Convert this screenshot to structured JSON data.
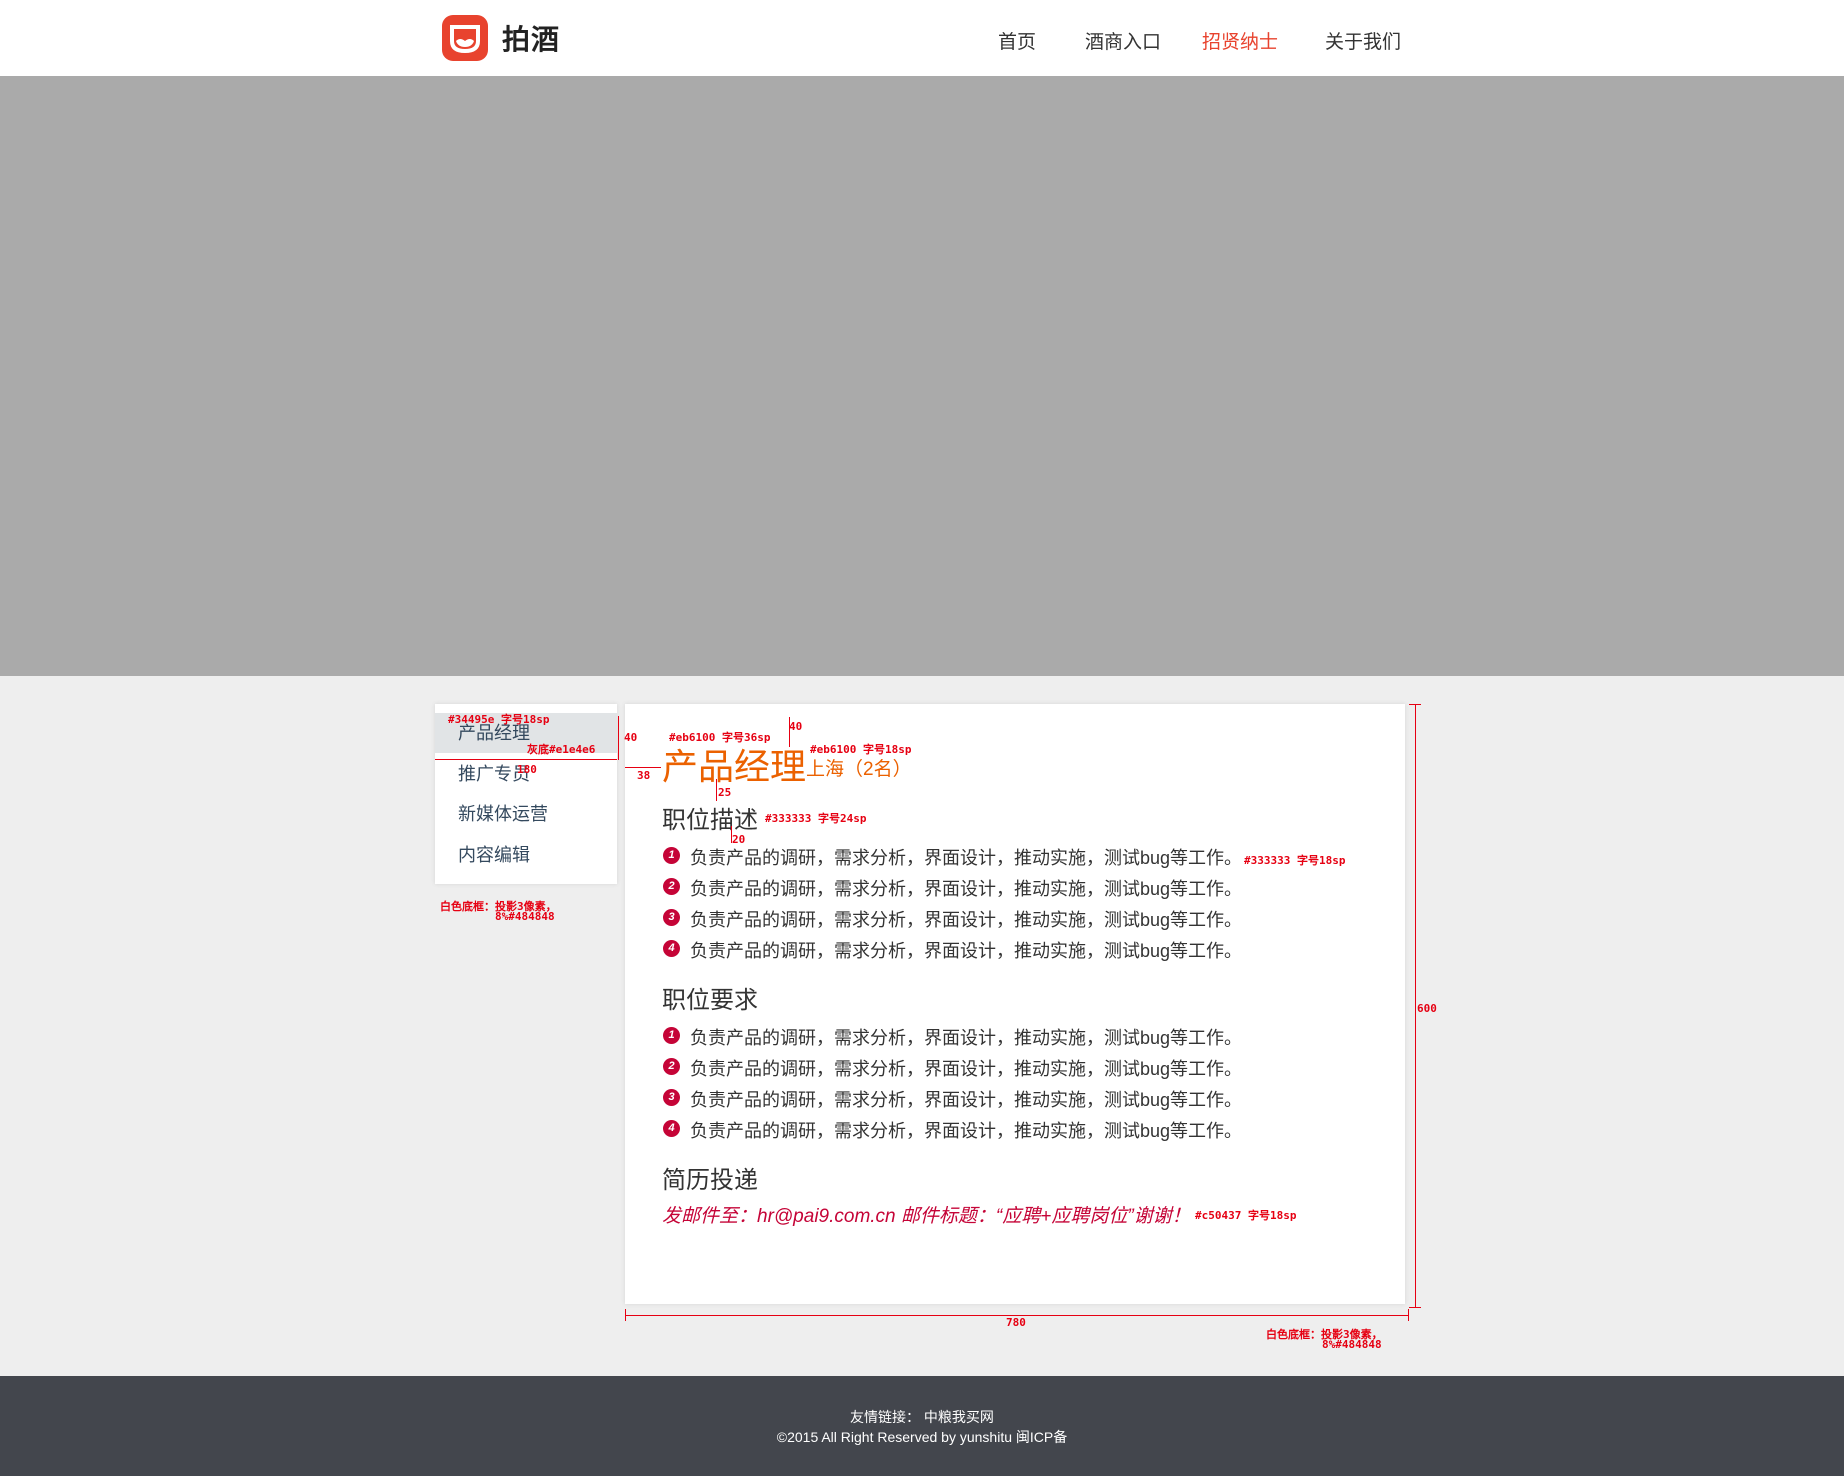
{
  "header": {
    "logo_text": "拍酒",
    "nav": [
      "首页",
      "酒商入口",
      "招贤纳士",
      "关于我们"
    ],
    "active_nav": "招贤纳士"
  },
  "sidebar": {
    "items": [
      "产品经理",
      "推广专员",
      "新媒体运营",
      "内容编辑"
    ]
  },
  "job": {
    "title": "产品经理",
    "location": "上海（2名）",
    "desc_title": "职位描述",
    "desc_items": [
      "负责产品的调研，需求分析，界面设计，推动实施，测试bug等工作。",
      "负责产品的调研，需求分析，界面设计，推动实施，测试bug等工作。",
      "负责产品的调研，需求分析，界面设计，推动实施，测试bug等工作。",
      "负责产品的调研，需求分析，界面设计，推动实施，测试bug等工作。"
    ],
    "req_title": "职位要求",
    "req_items": [
      "负责产品的调研，需求分析，界面设计，推动实施，测试bug等工作。",
      "负责产品的调研，需求分析，界面设计，推动实施，测试bug等工作。",
      "负责产品的调研，需求分析，界面设计，推动实施，测试bug等工作。",
      "负责产品的调研，需求分析，界面设计，推动实施，测试bug等工作。"
    ],
    "resume_title": "简历投递",
    "resume_text": "发邮件至：hr@pai9.com.cn 邮件标题：“应聘+应聘岗位”谢谢！"
  },
  "annotations": {
    "side_active_color": "#34495e 字号18sp",
    "side_active_bg": "灰底#e1e4e6",
    "side_width": "180",
    "side_item_height": "40",
    "side_shadow_l1": "白色底框：投影3像素，",
    "side_shadow_l2": "8%#484848",
    "title_color": "#eb6100 字号36sp",
    "loc_color": "#eb6100 字号18sp",
    "top_gap": "40",
    "left_gap": "38",
    "gap_25": "25",
    "gap_20": "20",
    "section_title_style": "#333333 字号24sp",
    "item_style": "#333333 字号18sp",
    "resume_style": "#c50437 字号18sp",
    "card_height": "600",
    "card_width": "780",
    "card_shadow_l1": "白色底框：投影3像素，",
    "card_shadow_l2": "8%#484848"
  },
  "footer": {
    "links": "友情链接：  中粮我买网",
    "copyright": "©2015 All Right Reserved by yunshitu 闽ICP备"
  },
  "colors": {
    "accent": "#e8432e",
    "title_orange": "#eb6100",
    "list_red": "#c50437",
    "sidebar_text": "#34495e",
    "sidebar_active_bg": "#e1e4e6",
    "footer_bg": "#43464d",
    "banner_gray": "#aaaaaa"
  }
}
